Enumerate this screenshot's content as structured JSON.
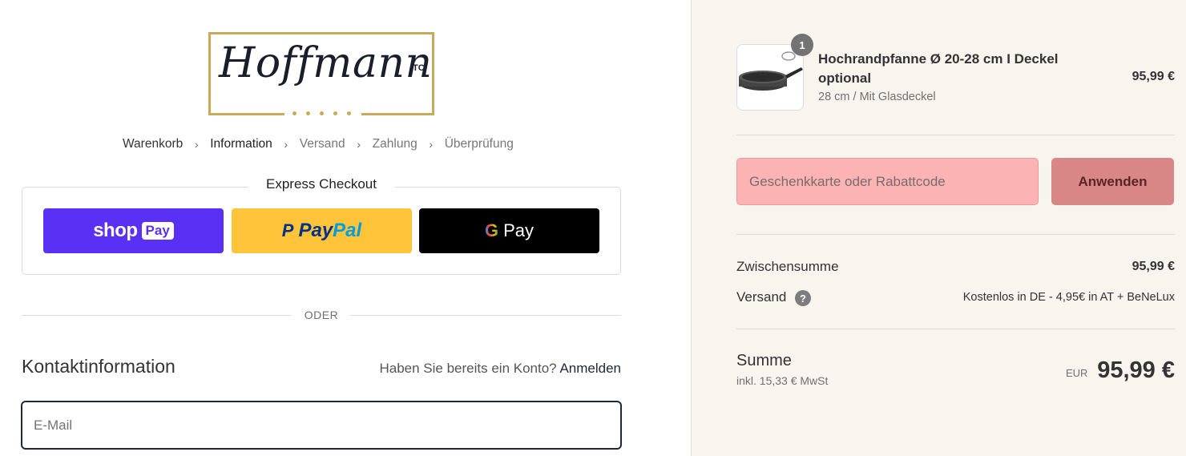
{
  "brand": {
    "logo_text": "Hoffmann",
    "logo_sup": "TC",
    "accent": "#c9aa58"
  },
  "breadcrumb": [
    {
      "label": "Warenkorb",
      "state": "link"
    },
    {
      "label": "Information",
      "state": "current"
    },
    {
      "label": "Versand",
      "state": "muted"
    },
    {
      "label": "Zahlung",
      "state": "muted"
    },
    {
      "label": "Überprüfung",
      "state": "muted"
    }
  ],
  "express": {
    "title": "Express Checkout",
    "shop_pay": {
      "word": "shop",
      "box": "Pay",
      "color": "#5a31f4"
    },
    "paypal": {
      "icon": "P",
      "part1": "Pay",
      "part2": "Pal",
      "color": "#ffc439"
    },
    "gpay": {
      "g": "G",
      "label": "Pay",
      "color": "#000000"
    }
  },
  "divider": {
    "label": "ODER"
  },
  "contact": {
    "title": "Kontaktinformation",
    "account_prompt": "Haben Sie bereits ein Konto?",
    "login_link": "Anmelden",
    "email_placeholder": "E-Mail"
  },
  "cart": {
    "item": {
      "quantity": "1",
      "name": "Hochrandpfanne Ø 20-28 cm I Deckel optional",
      "variant": "28 cm / Mit Glasdeckel",
      "price": "95,99 €",
      "image_icon": "frying-pan-icon"
    },
    "discount": {
      "placeholder": "Geschenkkarte oder Rabattcode",
      "button": "Anwenden"
    },
    "subtotal": {
      "label": "Zwischensumme",
      "value": "95,99 €"
    },
    "shipping": {
      "label": "Versand",
      "help": "?",
      "value": "Kostenlos in DE - 4,95€ in AT + BeNeLux"
    },
    "total": {
      "label": "Summe",
      "tax": "inkl. 15,33 € MwSt",
      "currency": "EUR",
      "value": "95,99 €"
    }
  }
}
